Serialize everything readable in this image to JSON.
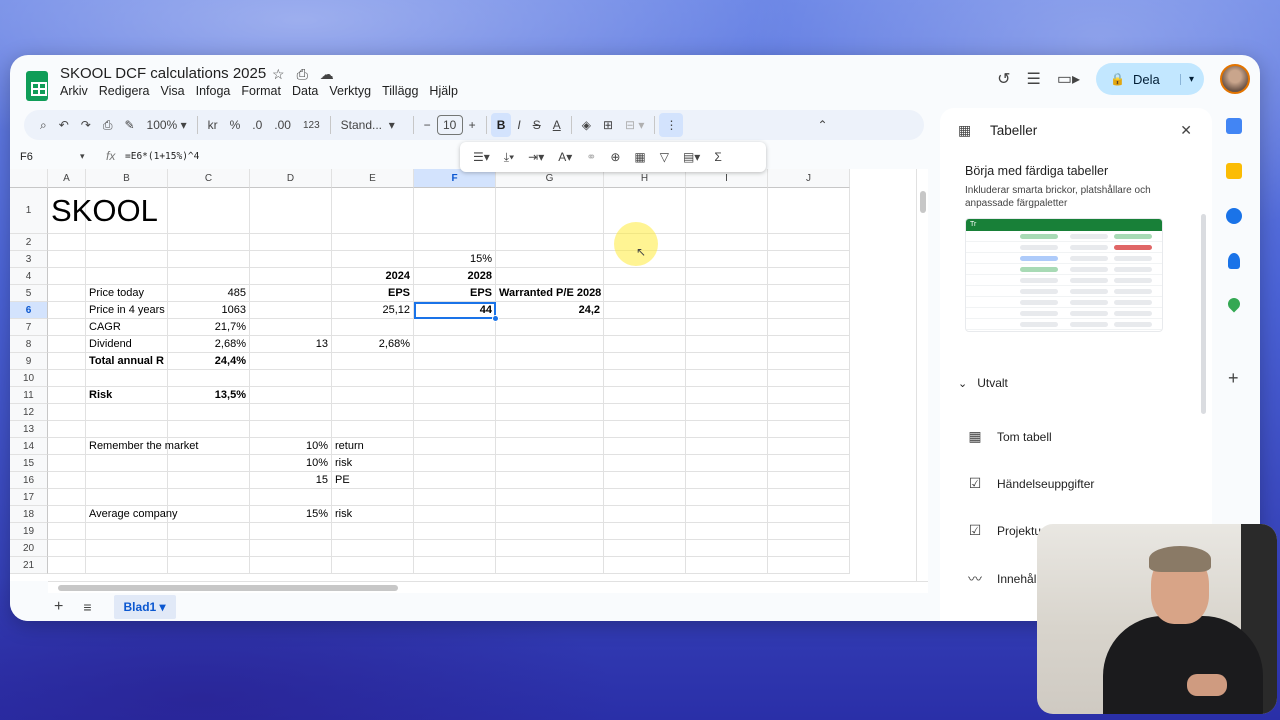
{
  "doc": {
    "title": "SKOOL DCF calculations 2025",
    "menu": [
      "Arkiv",
      "Redigera",
      "Visa",
      "Infoga",
      "Format",
      "Data",
      "Verktyg",
      "Tillägg",
      "Hjälp"
    ],
    "share_label": "Dela"
  },
  "toolbar": {
    "zoom": "100%",
    "currency": "kr",
    "percent": "%",
    "dec_less": ".0",
    "dec_more": ".00",
    "number_format": "123",
    "font": "Stand...",
    "font_size": "10",
    "minus": "−",
    "plus": "+",
    "bold": "B",
    "italic": "I",
    "strike": "S",
    "text_color": "A"
  },
  "formula_bar": {
    "cell_ref": "F6",
    "fx": "fx",
    "formula": "=E6*(1+15%)^4"
  },
  "grid": {
    "columns": [
      "A",
      "B",
      "C",
      "D",
      "E",
      "F",
      "G",
      "H",
      "I",
      "J"
    ],
    "rows": [
      "1",
      "2",
      "3",
      "4",
      "5",
      "6",
      "7",
      "8",
      "9",
      "10",
      "11",
      "12",
      "13",
      "14",
      "15",
      "16",
      "17",
      "18",
      "19",
      "20",
      "21"
    ],
    "cells": {
      "A1": "SKOOL",
      "F3": "15%",
      "E4": "2024",
      "F4": "2028",
      "B5": "Price today",
      "C5": "485",
      "E5": "EPS",
      "F5": "EPS",
      "G5": "Warranted P/E 2028",
      "B6": "Price in 4 years",
      "C6": "1063",
      "E6": "25,12",
      "F6": "44",
      "G6": "24,2",
      "B7": "CAGR",
      "C7": "21,7%",
      "B8": "Dividend",
      "C8": "2,68%",
      "D8": "13",
      "E8": "2,68%",
      "B9": "Total annual R",
      "C9": "24,4%",
      "B11": "Risk",
      "C11": "13,5%",
      "B14": "Remember the market",
      "D14": "10%",
      "E14": "return",
      "D15": "10%",
      "E15": "risk",
      "D16": "15",
      "E16": "PE",
      "B18": "Average company",
      "D18": "15%",
      "E18": "risk"
    }
  },
  "sheets": {
    "active_tab": "Blad1"
  },
  "panel": {
    "title": "Tabeller",
    "heading": "Börja med färdiga tabeller",
    "description": "Inkluderar smarta brickor, platshållare och anpassade färgpaletter",
    "section": "Utvalt",
    "items": [
      "Tom tabell",
      "Händelseuppgifter",
      "Projektup",
      "Innehåll"
    ],
    "preview_header_text": "Tr"
  },
  "colors": {
    "accent": "#1a73e8",
    "share_bg": "#c2e7ff",
    "sheets_green": "#0f9d58",
    "table_header": "#188038"
  }
}
